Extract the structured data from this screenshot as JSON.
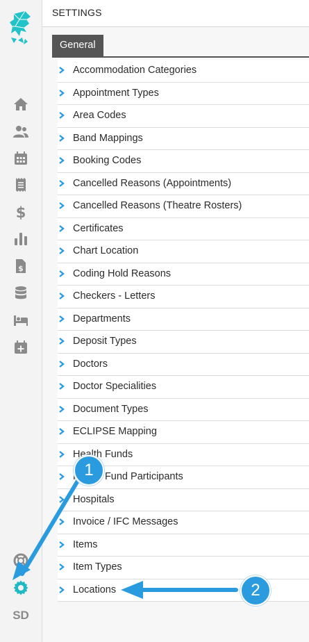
{
  "header": {
    "title": "SETTINGS"
  },
  "tabs": [
    {
      "label": "General"
    }
  ],
  "settings_items": [
    "Accommodation Categories",
    "Appointment Types",
    "Area Codes",
    "Band Mappings",
    "Booking Codes",
    "Cancelled Reasons (Appointments)",
    "Cancelled Reasons (Theatre Rosters)",
    "Certificates",
    "Chart Location",
    "Coding Hold Reasons",
    "Checkers - Letters",
    "Departments",
    "Deposit Types",
    "Doctors",
    "Doctor Specialities",
    "Document Types",
    "ECLIPSE Mapping",
    "Health Funds",
    "Health Fund Participants",
    "Hospitals",
    "Invoice / IFC Messages",
    "Items",
    "Item Types",
    "Locations"
  ],
  "sidebar": {
    "icons": [
      "home-icon",
      "users-icon",
      "calendar-icon",
      "receipt-icon",
      "dollar-icon",
      "bar-chart-icon",
      "invoice-icon",
      "database-icon",
      "bed-icon",
      "calendar-plus-icon",
      "help-icon",
      "settings-icon"
    ],
    "user_initials": "SD"
  },
  "annotations": {
    "badge1": "1",
    "badge2": "2"
  },
  "colors": {
    "accent": "#2b9be0",
    "logo": "#21c3c8",
    "tab_bg": "#555555",
    "icon_gray": "#8a8a8a"
  }
}
